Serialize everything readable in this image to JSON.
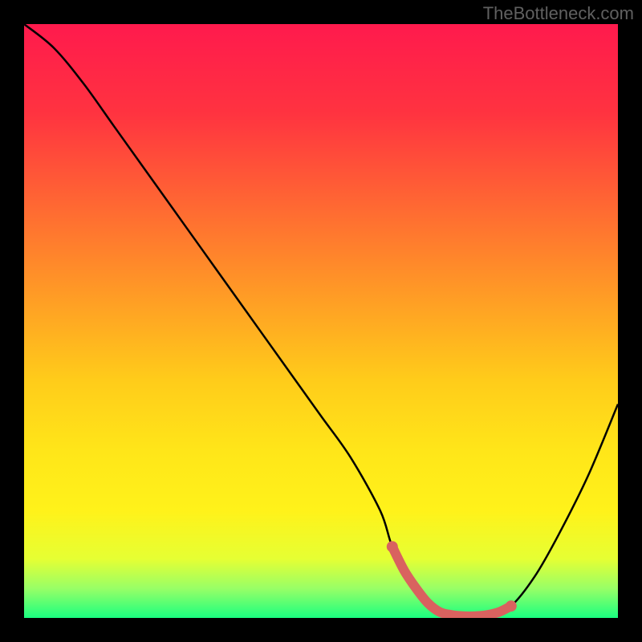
{
  "watermark": "TheBottleneck.com",
  "chart_data": {
    "type": "line",
    "title": "",
    "xlabel": "",
    "ylabel": "",
    "xlim": [
      0,
      100
    ],
    "ylim": [
      0,
      100
    ],
    "series": [
      {
        "name": "bottleneck-curve",
        "x": [
          0,
          5,
          10,
          15,
          20,
          25,
          30,
          35,
          40,
          45,
          50,
          55,
          60,
          62,
          65,
          68,
          72,
          75,
          78,
          82,
          86,
          90,
          95,
          100
        ],
        "values": [
          100,
          96,
          90,
          83,
          76,
          69,
          62,
          55,
          48,
          41,
          34,
          27,
          18,
          12,
          6,
          2,
          0,
          0,
          0,
          2,
          7,
          14,
          24,
          36
        ]
      },
      {
        "name": "optimal-marker",
        "x": [
          62,
          64,
          66,
          68,
          70,
          72,
          74,
          76,
          78,
          80,
          82
        ],
        "values": [
          12,
          8,
          5,
          2.5,
          1,
          0.5,
          0.3,
          0.3,
          0.5,
          1,
          2
        ]
      }
    ],
    "gradient_stops": [
      {
        "offset": 0.0,
        "color": "#ff1a4d"
      },
      {
        "offset": 0.15,
        "color": "#ff3340"
      },
      {
        "offset": 0.3,
        "color": "#ff6633"
      },
      {
        "offset": 0.45,
        "color": "#ff9926"
      },
      {
        "offset": 0.6,
        "color": "#ffcc1a"
      },
      {
        "offset": 0.72,
        "color": "#ffe619"
      },
      {
        "offset": 0.82,
        "color": "#fff21a"
      },
      {
        "offset": 0.9,
        "color": "#e6ff33"
      },
      {
        "offset": 0.95,
        "color": "#99ff66"
      },
      {
        "offset": 1.0,
        "color": "#1aff80"
      }
    ]
  }
}
